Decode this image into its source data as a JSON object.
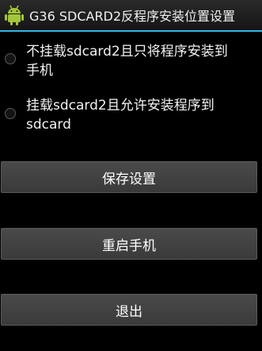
{
  "window": {
    "title": "G36 SDCARD2反程序安装位置设置",
    "icon": "android-robot-icon"
  },
  "options": [
    {
      "label": "不挂载sdcard2且只将程序安装到手机",
      "selected": false
    },
    {
      "label": "挂载sdcard2且允许安装程序到sdcard",
      "selected": false
    }
  ],
  "buttons": {
    "save_label": "保存设置",
    "reboot_label": "重启手机",
    "exit_label": "退出"
  },
  "colors": {
    "background": "#000000",
    "accent": "#33b5e5",
    "android_green": "#a4c639",
    "button": "#404040"
  }
}
